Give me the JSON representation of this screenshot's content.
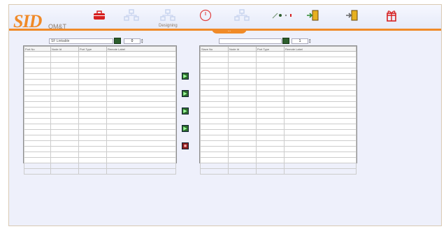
{
  "header": {
    "logo": "SID",
    "logo_sub": "OM&T",
    "toolbar": [
      {
        "name": "briefcase-icon",
        "color": "#d62020"
      },
      {
        "name": "network-icon",
        "color": "#c8d4ee"
      },
      {
        "name": "network-designing-icon",
        "color": "#c8d4ee",
        "label": "Designing"
      },
      {
        "name": "clock-icon",
        "color": "#d62020"
      },
      {
        "name": "network-icon",
        "color": "#c8d4ee"
      },
      {
        "name": "link-status-icon",
        "color": "#7a9a7a"
      },
      {
        "name": "door-enter-icon",
        "color": "#e6b020"
      },
      {
        "name": "door-exit-icon",
        "color": "#e6b020"
      },
      {
        "name": "gift-icon",
        "color": "#d62020"
      }
    ],
    "active_tab": "..."
  },
  "left_panel": {
    "select_value": "SF Linkable",
    "count": "0",
    "columns": [
      "Port No",
      "Node Id",
      "Port Type",
      "Remote Label"
    ],
    "row_count": 22
  },
  "right_panel": {
    "select_value": "",
    "count": "1",
    "columns": [
      "Slave No",
      "Node Id",
      "Port Type",
      "Remote Label"
    ],
    "row_count": 22
  },
  "move_buttons": [
    "add",
    "add",
    "add",
    "add",
    "remove"
  ],
  "colors": {
    "accent": "#f08a28",
    "frame_bg": "#eef0fb",
    "go_button": "#2d5e2d",
    "remove_button": "#8a1e1e"
  }
}
